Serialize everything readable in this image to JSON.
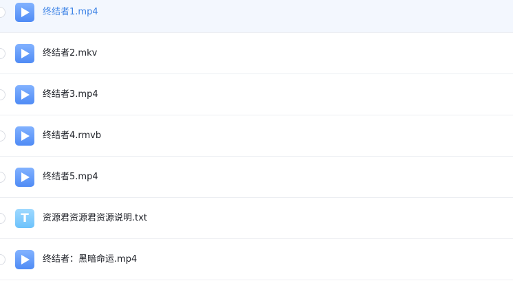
{
  "files": [
    {
      "name": "终结者1.mp4",
      "type": "video",
      "icon": "play-icon",
      "selected": true
    },
    {
      "name": "终结者2.mkv",
      "type": "video",
      "icon": "play-icon",
      "selected": false
    },
    {
      "name": "终结者3.mp4",
      "type": "video",
      "icon": "play-icon",
      "selected": false
    },
    {
      "name": "终结者4.rmvb",
      "type": "video",
      "icon": "play-icon",
      "selected": false
    },
    {
      "name": "终结者5.mp4",
      "type": "video",
      "icon": "play-icon",
      "selected": false
    },
    {
      "name": "资源君资源君资源说明.txt",
      "type": "text",
      "icon": "text-file-icon",
      "icon_letter": "T",
      "selected": false
    },
    {
      "name": "终结者：黑暗命运.mp4",
      "type": "video",
      "icon": "play-icon",
      "selected": false
    }
  ],
  "colors": {
    "selected_row_bg": "#f3f7fe",
    "selected_text": "#3b82e6",
    "video_icon": "#5b93f7",
    "text_icon": "#7ccbfc",
    "divider": "#eceef2"
  }
}
